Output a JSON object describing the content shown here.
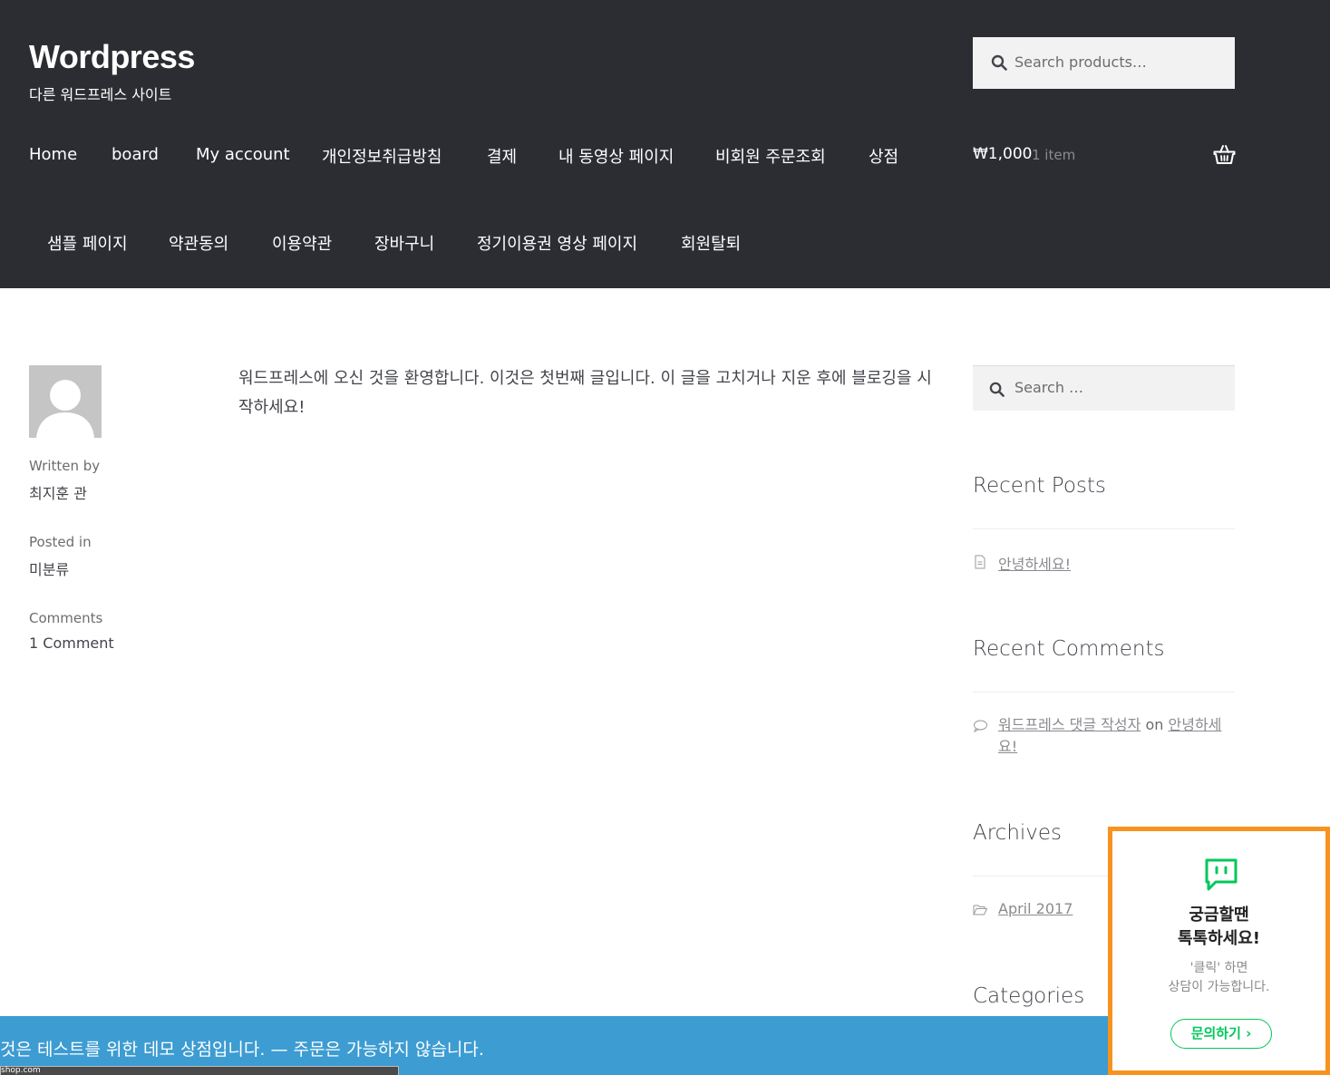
{
  "header": {
    "site_title": "Wordpress",
    "site_description": "다른 워드프레스 사이트",
    "search_placeholder": "Search products…",
    "nav_row1": [
      "Home",
      "board",
      "My account",
      "개인정보취급방침",
      "결제",
      "내 동영상 페이지",
      "비회원 주문조회",
      "상점"
    ],
    "nav_row2": [
      "샘플 페이지",
      "약관동의",
      "이용약관",
      "장바구니",
      "정기이용권 영상 페이지",
      "회원탈퇴"
    ],
    "cart": {
      "amount": "₩1,000",
      "count": "1 item"
    }
  },
  "post": {
    "meta": [
      {
        "label": "Written by",
        "value": "최지훈 관"
      },
      {
        "label": "Posted in",
        "value": "미분류"
      },
      {
        "label": "Comments",
        "value": "1 Comment"
      }
    ],
    "content": "워드프레스에 오신 것을 환영합니다. 이것은 첫번째 글입니다. 이 글을 고치거나 지운 후에 블로깅을 시작하세요!"
  },
  "sidebar": {
    "search_placeholder": "Search …",
    "recent_posts": {
      "title": "Recent Posts",
      "items": [
        "안녕하세요!"
      ]
    },
    "recent_comments": {
      "title": "Recent Comments",
      "author": "워드프레스 댓글 작성자",
      "on": "on",
      "post_line1": "안녕하세",
      "post_line2": "요!"
    },
    "archives": {
      "title": "Archives",
      "items": [
        "April 2017"
      ]
    },
    "categories": {
      "title": "Categories"
    }
  },
  "demo_notice": "것은 테스트를 위한 데모 상점입니다. — 주문은 가능하지 않습니다.",
  "status_url": "shop.com",
  "chat_widget": {
    "headline_line1": "궁금할땐",
    "headline_line2": "톡톡하세요!",
    "sub_line1": "'클릭' 하면",
    "sub_line2": "상담이 가능합니다.",
    "button": "문의하기 ›"
  },
  "colors": {
    "header_bg": "#2c2d33",
    "demo_bar": "#3d9cd2",
    "chat_border": "#f7931e",
    "chat_green": "#03c75a"
  }
}
